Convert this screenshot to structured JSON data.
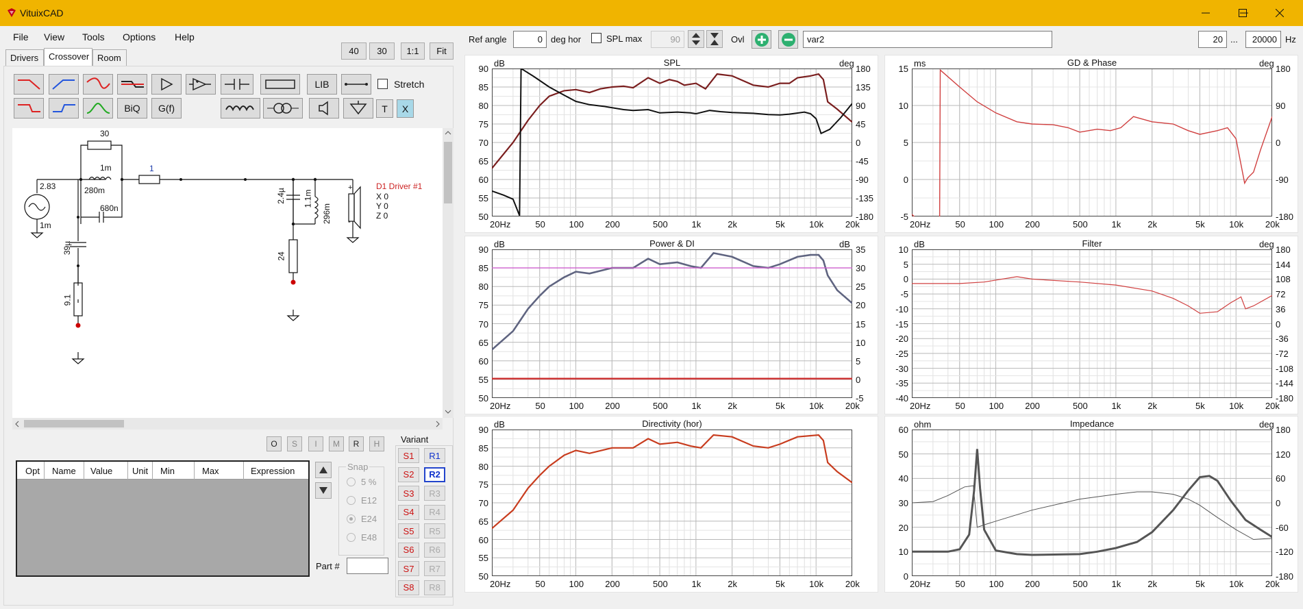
{
  "app": {
    "title": "VituixCAD"
  },
  "menu": [
    "File",
    "View",
    "Tools",
    "Options",
    "Help"
  ],
  "tabs": [
    "Drivers",
    "Crossover",
    "Room"
  ],
  "zoom": [
    "40",
    "30",
    "1:1",
    "Fit"
  ],
  "toolbar": {
    "lib": "LIB",
    "biq": "BiQ",
    "gf": "G(f)",
    "t": "T",
    "x": "X",
    "stretch": "Stretch"
  },
  "schematic": {
    "r1": "30",
    "l1": "1m",
    "l1r": "280m",
    "c1": "680n",
    "r2": "1",
    "src_v": "2.83",
    "src_r": "1m",
    "c2": "39µ",
    "r3": "9.1",
    "c3": "2.4µ",
    "l2": "1.1m",
    "l2r": "296m",
    "r4": "24",
    "driver": "D1 Driver #1",
    "dx": "X 0",
    "dy": "Y 0",
    "dz": "Z 0"
  },
  "optbuttons": [
    "O",
    "S",
    "I",
    "M",
    "R",
    "H"
  ],
  "table": {
    "headers": [
      "Opt",
      "Name",
      "Value",
      "Unit",
      "Min",
      "Max",
      "Expression"
    ]
  },
  "snap": {
    "title": "Snap",
    "options": [
      "5 %",
      "E12",
      "E24",
      "E48"
    ]
  },
  "variant": {
    "title": "Variant",
    "s": [
      "S1",
      "S2",
      "S3",
      "S4",
      "S5",
      "S6",
      "S7",
      "S8"
    ],
    "r": [
      "R1",
      "R2",
      "R3",
      "R4",
      "R5",
      "R6",
      "R7",
      "R8"
    ]
  },
  "partno": "Part #",
  "top": {
    "ref_label": "Ref angle",
    "ref_value": "0",
    "deg_hor": "deg hor",
    "splmax": "SPL max",
    "splmax_val": "90",
    "ovl": "Ovl",
    "var": "var2",
    "f1": "20",
    "dots": "...",
    "f2": "20000",
    "hz": "Hz"
  },
  "xticks": [
    "20Hz",
    "50",
    "100",
    "200",
    "500",
    "1k",
    "2k",
    "5k",
    "10k",
    "20k"
  ],
  "charts": {
    "spl": {
      "title": "SPL",
      "lu": "dB",
      "ru": "deg",
      "left": [
        "90",
        "85",
        "80",
        "75",
        "70",
        "65",
        "60",
        "55",
        "50"
      ],
      "right": [
        "180",
        "135",
        "90",
        "45",
        "0",
        "-45",
        "-90",
        "-135",
        "-180"
      ]
    },
    "gd": {
      "title": "GD & Phase",
      "lu": "ms",
      "ru": "deg",
      "left": [
        "15",
        "10",
        "5",
        "0",
        "-5"
      ],
      "right": [
        "180",
        "90",
        "0",
        "-90",
        "-180"
      ]
    },
    "pw": {
      "title": "Power & DI",
      "lu": "dB",
      "ru": "dB",
      "left": [
        "90",
        "85",
        "80",
        "75",
        "70",
        "65",
        "60",
        "55",
        "50"
      ],
      "right": [
        "35",
        "30",
        "25",
        "20",
        "15",
        "10",
        "5",
        "0",
        "-5"
      ]
    },
    "flt": {
      "title": "Filter",
      "lu": "dB",
      "ru": "deg",
      "left": [
        "10",
        "5",
        "0",
        "-5",
        "-10",
        "-15",
        "-20",
        "-25",
        "-30",
        "-35",
        "-40"
      ],
      "right": [
        "180",
        "144",
        "108",
        "72",
        "36",
        "0",
        "-36",
        "-72",
        "-108",
        "-144",
        "-180"
      ]
    },
    "dir": {
      "title": "Directivity (hor)",
      "lu": "dB",
      "ru": "",
      "left": [
        "90",
        "85",
        "80",
        "75",
        "70",
        "65",
        "60",
        "55",
        "50"
      ],
      "right": []
    },
    "imp": {
      "title": "Impedance",
      "lu": "ohm",
      "ru": "deg",
      "left": [
        "60",
        "50",
        "40",
        "30",
        "20",
        "10",
        "0"
      ],
      "right": [
        "180",
        "120",
        "60",
        "0",
        "-60",
        "-120",
        "-180"
      ]
    }
  },
  "colors": {
    "titlebar": "#f0b400",
    "spl": "#7a1e1e",
    "phase": "#111111",
    "gd": "#d04040",
    "power": "#5f6480",
    "di": "#cc3333",
    "flat": "#d060d0",
    "dir": "#c83c1e",
    "imp": "#555555"
  }
}
